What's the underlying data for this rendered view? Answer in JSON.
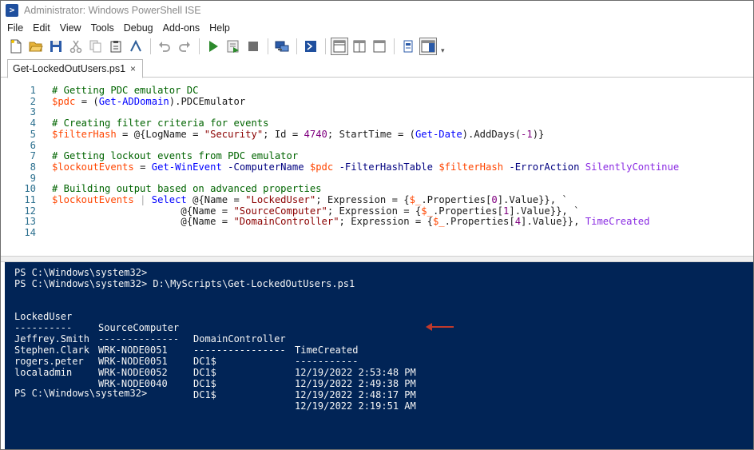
{
  "window": {
    "title": "Administrator: Windows PowerShell ISE",
    "app_icon_glyph": ">"
  },
  "menu": [
    "File",
    "Edit",
    "View",
    "Tools",
    "Debug",
    "Add-ons",
    "Help"
  ],
  "toolbar": {
    "buttons": [
      "new-script",
      "open",
      "save",
      "cut",
      "copy",
      "paste",
      "clear-console",
      "undo",
      "redo",
      "run-script",
      "run-selection",
      "stop",
      "new-remote-tab",
      "start-powershell",
      "show-script-pane-top",
      "show-script-pane-right",
      "show-script-pane-maximized",
      "show-command-window",
      "show-command-addon"
    ],
    "more_glyph": "▾"
  },
  "tabs": [
    {
      "label": "Get-LockedOutUsers.ps1",
      "close": "×"
    }
  ],
  "editor": {
    "lines": [
      {
        "n": "1",
        "tokens": [
          {
            "t": "# Getting PDC emulator DC",
            "c": "comment"
          }
        ]
      },
      {
        "n": "2",
        "tokens": [
          {
            "t": "$pdc",
            "c": "var"
          },
          {
            "t": " = ",
            "c": "plain"
          },
          {
            "t": "(",
            "c": "plain"
          },
          {
            "t": "Get-ADDomain",
            "c": "cmd"
          },
          {
            "t": ").PDCEmulator",
            "c": "plain"
          }
        ]
      },
      {
        "n": "3",
        "tokens": []
      },
      {
        "n": "4",
        "tokens": [
          {
            "t": "# Creating filter criteria for events",
            "c": "comment"
          }
        ]
      },
      {
        "n": "5",
        "tokens": [
          {
            "t": "$filterHash",
            "c": "var"
          },
          {
            "t": " = @{LogName = ",
            "c": "plain"
          },
          {
            "t": "\"Security\"",
            "c": "str"
          },
          {
            "t": "; Id = ",
            "c": "plain"
          },
          {
            "t": "4740",
            "c": "num"
          },
          {
            "t": "; StartTime = (",
            "c": "plain"
          },
          {
            "t": "Get-Date",
            "c": "cmd"
          },
          {
            "t": ").AddDays(",
            "c": "plain"
          },
          {
            "t": "-1",
            "c": "num"
          },
          {
            "t": ")}",
            "c": "plain"
          }
        ]
      },
      {
        "n": "6",
        "tokens": []
      },
      {
        "n": "7",
        "tokens": [
          {
            "t": "# Getting lockout events from PDC emulator",
            "c": "comment"
          }
        ]
      },
      {
        "n": "8",
        "tokens": [
          {
            "t": "$lockoutEvents",
            "c": "var"
          },
          {
            "t": " = ",
            "c": "plain"
          },
          {
            "t": "Get-WinEvent",
            "c": "cmd"
          },
          {
            "t": " -ComputerName",
            "c": "param"
          },
          {
            "t": " $pdc",
            "c": "var"
          },
          {
            "t": " -FilterHashTable",
            "c": "param"
          },
          {
            "t": " $filterHash",
            "c": "var"
          },
          {
            "t": " -ErrorAction",
            "c": "param"
          },
          {
            "t": " SilentlyContinue",
            "c": "arg"
          }
        ]
      },
      {
        "n": "9",
        "tokens": []
      },
      {
        "n": "10",
        "tokens": [
          {
            "t": "# Building output based on advanced properties",
            "c": "comment"
          }
        ]
      },
      {
        "n": "11",
        "tokens": [
          {
            "t": "$lockoutEvents",
            "c": "var"
          },
          {
            "t": " | ",
            "c": "op"
          },
          {
            "t": "Select",
            "c": "cmd"
          },
          {
            "t": " @{Name = ",
            "c": "plain"
          },
          {
            "t": "\"LockedUser\"",
            "c": "str"
          },
          {
            "t": "; Expression = {",
            "c": "plain"
          },
          {
            "t": "$_",
            "c": "var"
          },
          {
            "t": ".Properties[",
            "c": "plain"
          },
          {
            "t": "0",
            "c": "num"
          },
          {
            "t": "].Value}}, `",
            "c": "plain"
          }
        ]
      },
      {
        "n": "12",
        "tokens": [
          {
            "t": "                      @{Name = ",
            "c": "plain"
          },
          {
            "t": "\"SourceComputer\"",
            "c": "str"
          },
          {
            "t": "; Expression = {",
            "c": "plain"
          },
          {
            "t": "$_",
            "c": "var"
          },
          {
            "t": ".Properties[",
            "c": "plain"
          },
          {
            "t": "1",
            "c": "num"
          },
          {
            "t": "].Value}}, `",
            "c": "plain"
          }
        ]
      },
      {
        "n": "13",
        "tokens": [
          {
            "t": "                      @{Name = ",
            "c": "plain"
          },
          {
            "t": "\"DomainController\"",
            "c": "str"
          },
          {
            "t": "; Expression = {",
            "c": "plain"
          },
          {
            "t": "$_",
            "c": "var"
          },
          {
            "t": ".Properties[",
            "c": "plain"
          },
          {
            "t": "4",
            "c": "num"
          },
          {
            "t": "].Value}}, ",
            "c": "plain"
          },
          {
            "t": "TimeCreated",
            "c": "arg"
          }
        ]
      },
      {
        "n": "14",
        "tokens": []
      }
    ]
  },
  "console": {
    "prompt1": "PS C:\\Windows\\system32>",
    "prompt2": "PS C:\\Windows\\system32> D:\\MyScripts\\Get-LockedOutUsers.ps1",
    "headers": [
      "LockedUser",
      "SourceComputer",
      "DomainController",
      "TimeCreated"
    ],
    "underlines": [
      "----------",
      "--------------",
      "----------------",
      "-----------"
    ],
    "rows": [
      [
        "Jeffrey.Smith",
        "WRK-NODE0051",
        "DC1$",
        "12/19/2022 2:53:48 PM"
      ],
      [
        "Stephen.Clark",
        "WRK-NODE0051",
        "DC1$",
        "12/19/2022 2:49:38 PM"
      ],
      [
        "rogers.peter",
        "WRK-NODE0052",
        "DC1$",
        "12/19/2022 2:48:17 PM"
      ],
      [
        "localadmin",
        "WRK-NODE0040",
        "DC1$",
        "12/19/2022 2:19:51 AM"
      ]
    ],
    "prompt3": "PS C:\\Windows\\system32>",
    "highlight_arrow_color": "#c0392b",
    "background": "#012456"
  }
}
